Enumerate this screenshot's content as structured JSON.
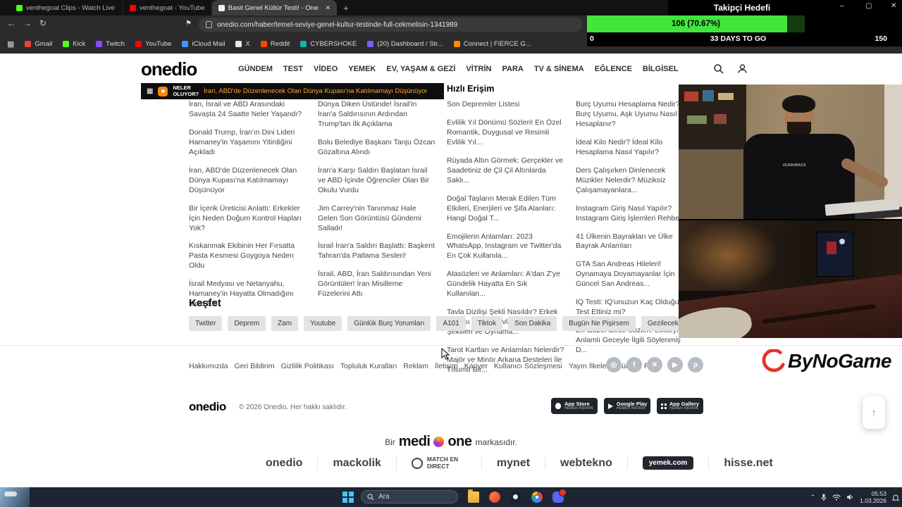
{
  "stream_overlay": {
    "goal_title": "Takipçi Hedefi",
    "goal_value_label": "106 (70.67%)",
    "goal_start": "0",
    "goal_countdown": "33 DAYS TO GO",
    "goal_end": "150",
    "bar_fill_color": "#41e63c"
  },
  "browser": {
    "tabs": [
      {
        "title": "venthegoat Clips - Watch Live on Kic...",
        "color": "#53fc18"
      },
      {
        "title": "venthegoat - YouTube",
        "color": "#ff0000"
      },
      {
        "title": "Basit Genel Kültür Testi! - Onedi...",
        "color": "#f2f2f2"
      }
    ],
    "url": "onedio.com/haber/temel-seviye-genel-kultur-testinde-full-cekmelisin-1341989",
    "bookmarks": [
      {
        "label": "Gmail",
        "color": "#ea4335"
      },
      {
        "label": "Kick",
        "color": "#53fc18"
      },
      {
        "label": "Twitch",
        "color": "#9146ff"
      },
      {
        "label": "YouTube",
        "color": "#ff0000"
      },
      {
        "label": "iCloud Mail",
        "color": "#3b99fc"
      },
      {
        "label": "X",
        "color": "#e7e9ea"
      },
      {
        "label": "Reddit",
        "color": "#ff4500"
      },
      {
        "label": "CYBERSHOKE",
        "color": "#18b2a5"
      },
      {
        "label": "(20) Dashboard / Str...",
        "color": "#7a5cff"
      },
      {
        "label": "Connect | FIERCE G...",
        "color": "#ff8a00"
      }
    ]
  },
  "site": {
    "logo": "onedio",
    "nav": [
      "GÜNDEM",
      "TEST",
      "VİDEO",
      "YEMEK",
      "EV, YAŞAM & GEZİ",
      "VİTRİN",
      "PARA",
      "TV & SİNEMA",
      "EĞLENCE",
      "BİLGİSEL"
    ],
    "ticker": {
      "label_line1": "NELER",
      "label_line2": "OLUYOR?",
      "headline": "İran, ABD'de Düzenlenecek Olan Dünya Kupası'na Katılmamayı Düşünüyor"
    },
    "columns": [
      {
        "header": "",
        "items": [
          "İran, İsrail ve ABD Arasındaki Savaşta 24 Saatte Neler Yaşandı?",
          "Donald Trump, İran'ın Dini Lideri Hamaney'in Yaşamını Yitirdiğini Açıkladı",
          "İran, ABD'de Düzenlenecek Olan Dünya Kupası'na Katılmamayı Düşünüyor",
          "Bir İçerik Üreticisi Anlattı: Erkekler İçin Neden Doğum Kontrol Hapları Yok?",
          "Kıskanmak Ekibinin Her Fırsatta Pasta Kesmesi Goygoya Neden Oldu",
          "İsrail Medyası ve Netanyahu, Hamaney'in Hayatta Olmadığını İddia Etti"
        ]
      },
      {
        "header": "",
        "items": [
          "Dünya Diken Üstünde! İsrail'in İran'a Saldırısının Ardından Trump'tan İlk Açıklama",
          "Bolu Belediye Başkanı Tanju Özcan Gözaltına Alındı",
          "İran'a Karşı Saldırı Başlatan İsrail ve ABD İçinde Öğrenciler Olan Bir Okulu Vurdu",
          "Jim Carrey'nin Tanınmaz Hale Gelen Son Görüntüsü Gündemi Salladı!",
          "İsrail İran'a Saldırı Başlattı: Başkent Tahran'da Patlama Sesleri!",
          "İsrail, ABD, İran Saldırısından Yeni Görüntüler! İran Misilleme Füzelerini Attı"
        ]
      },
      {
        "header": "Hızlı Erişim",
        "items": [
          "Son Depremler Listesi",
          "Evlilik Yıl Dönümü Sözleri! En Özel Romantik, Duygusal ve Resimli Evlilik Yıl...",
          "Rüyada Altın Görmek: Gerçekler ve Saadetiniz de Çil Çil Altınlarda Saklı...",
          "Doğal Taşların Merak Edilen Tüm Etkileri, Enerjileri ve Şifa Alanları: Hangi Doğal T...",
          "Emojilerin Anlamları: 2023 WhatsApp, Instagram ve Twitter'da En Çok Kullanıla...",
          "Atasözleri ve Anlamları: A'dan Z'ye Gündelik Hayatta En Sık Kullanılan...",
          "Tavla Dizilişi Şekli Nasıldır? Erkek Tavlası ve Kız Tavlası Diziliş Şekilleri ve Oynama...",
          "Tarot Kartları ve Anlamları Nelerdir? Majör ve Minör Arkana Desteleri İle Tılsımlı Bir..."
        ]
      },
      {
        "header": "",
        "items": [
          "Burç Uyumu Hesaplama Nedir? Burç Uyumu, Aşk Uyumu Nasıl Hesaplanır?",
          "İdeal Kilo Nedir? İdeal Kilo Hesaplama Nasıl Yapılır?",
          "Ders Çalışırken Dinlenecek Müzikler Nelerdir? Müziksiz Çalışamayanlara...",
          "Instagram Giriş Nasıl Yapılır? Instagram Giriş İşlemleri Rehberi",
          "41 Ülkenin Bayrakları ve Ülke Bayrak Anlamları",
          "GTA San Andreas Hileleri! Oynamaya Doyamayanlar İçin Güncel San Andreas...",
          "IQ Testi: IQ'unuzun Kaç Olduğunu Test Ettiniz mi?",
          "En Güzel Gece Sözleri: Etkileyici, Anlamlı Geceyle İlgili Söylenmiş D..."
        ]
      }
    ],
    "kesfet": {
      "title": "Keşfet",
      "tags": [
        "Twitter",
        "Deprem",
        "Zam",
        "Youtube",
        "Günlük Burç Yorumları",
        "A101",
        "Tiktok",
        "Son Dakika",
        "Bugün Ne Pişirsem",
        "Gezilecek Yerler"
      ]
    },
    "footer": {
      "links": [
        "Hakkımızda",
        "Geri Bildirim",
        "Gizlilik Politikası",
        "Topluluk Kuralları",
        "Reklam",
        "İletişim",
        "Kariyer",
        "Kullanıcı Sözleşmesi",
        "Yayın İlkeleri",
        "Künye",
        "RSS"
      ],
      "copyright": "© 2026 Onedio. Her hakkı saklıdır.",
      "logo": "onedio",
      "sponsor": "ByNoGame",
      "badges": [
        {
          "store": "App Store",
          "sub": "HEMEN İNDİRİN"
        },
        {
          "store": "Google Play",
          "sub": "HEMEN İNDİRİN"
        },
        {
          "store": "App Gallery",
          "sub": "HEMEN İNDİRİN"
        }
      ],
      "brand_line": {
        "prefix": "Bir",
        "brand_left": "medi",
        "brand_right": "one",
        "suffix": "markasıdır."
      },
      "partners": [
        "onedio",
        "mackolik",
        "MATCH EN DIRECT",
        "mynet",
        "webtekno",
        "yemek.com",
        "hisse.net"
      ]
    }
  },
  "webcam": {
    "shirt_text": "#EARNBACK"
  },
  "taskbar": {
    "search_placeholder": "Ara",
    "clock_time": "05:53",
    "clock_date": "1.03.2026"
  }
}
